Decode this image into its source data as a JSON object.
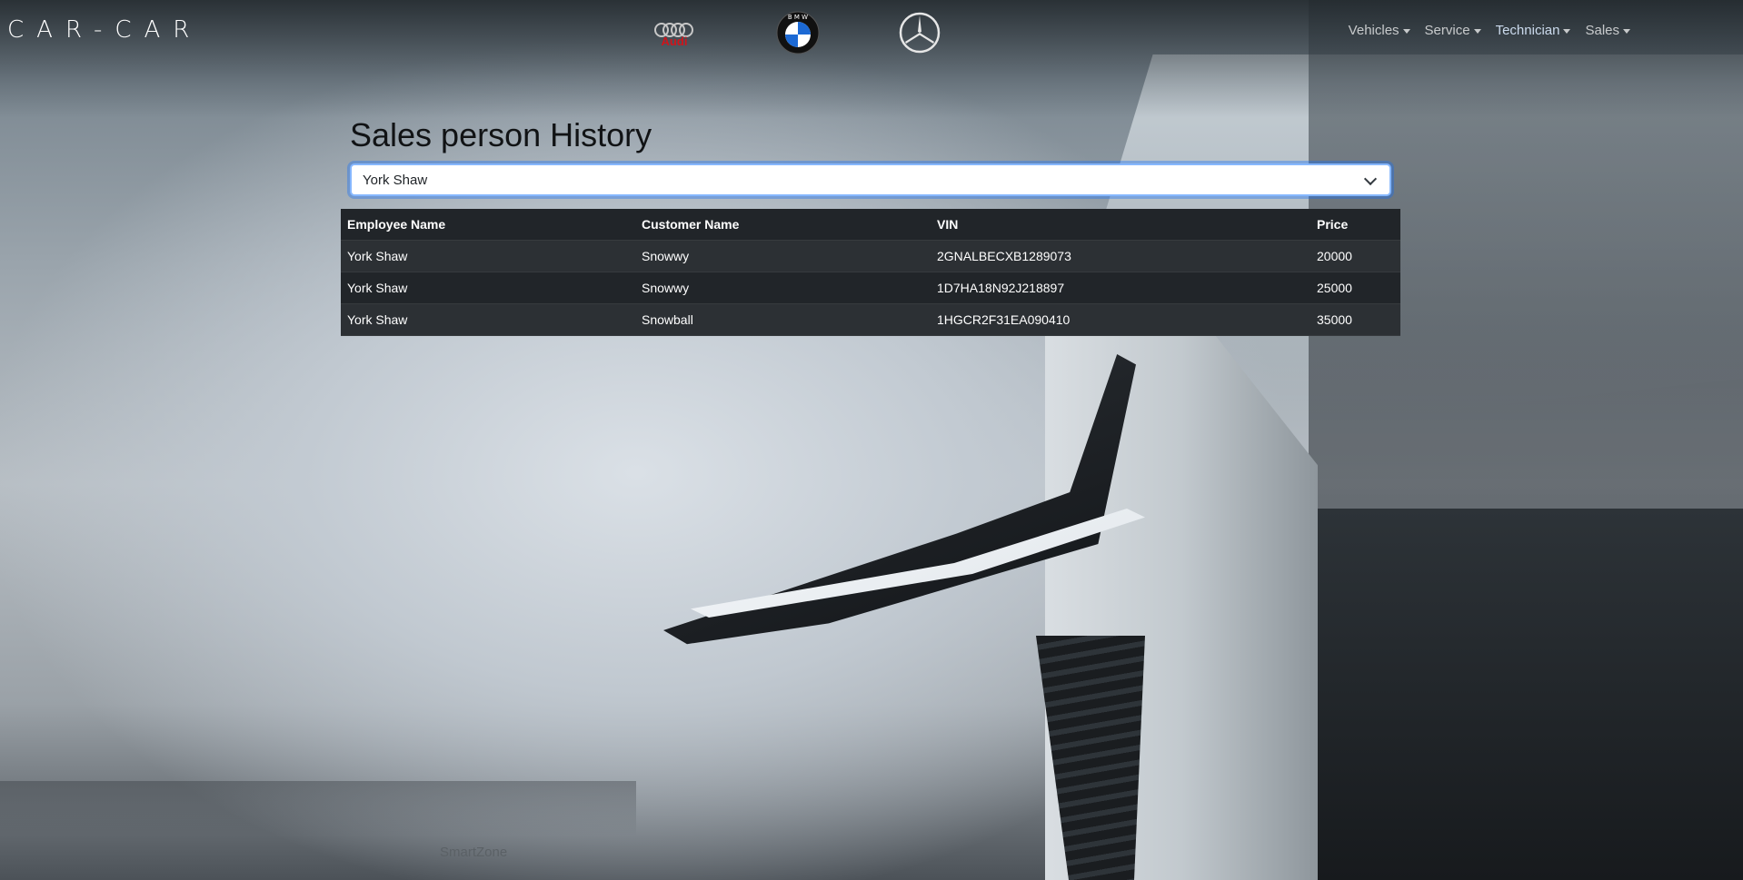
{
  "navbar": {
    "brand": "CAR-CAR",
    "logos": {
      "audi_text": "Audi",
      "bmw_text": "BMW",
      "mercedes_icon": "mercedes-star-icon"
    },
    "menu": [
      {
        "label": "Vehicles"
      },
      {
        "label": "Service"
      },
      {
        "label": "Technician"
      },
      {
        "label": "Sales"
      }
    ]
  },
  "main": {
    "title": "Sales person History",
    "select": {
      "value": "York Shaw"
    },
    "table": {
      "headers": [
        "Employee Name",
        "Customer Name",
        "VIN",
        "Price"
      ],
      "rows": [
        [
          "York Shaw",
          "Snowwy",
          "2GNALBECXB1289073",
          "20000"
        ],
        [
          "York Shaw",
          "Snowwy",
          "1D7HA18N92J218897",
          "25000"
        ],
        [
          "York Shaw",
          "Snowball",
          "1HGCR2F31EA090410",
          "35000"
        ]
      ]
    }
  },
  "background": {
    "caption": "SmartZone"
  },
  "colors": {
    "audi_red": "#d0141b",
    "bmw_blue": "#1c69d4",
    "table_dark": "#212529",
    "select_focus": "#86b7fe"
  }
}
